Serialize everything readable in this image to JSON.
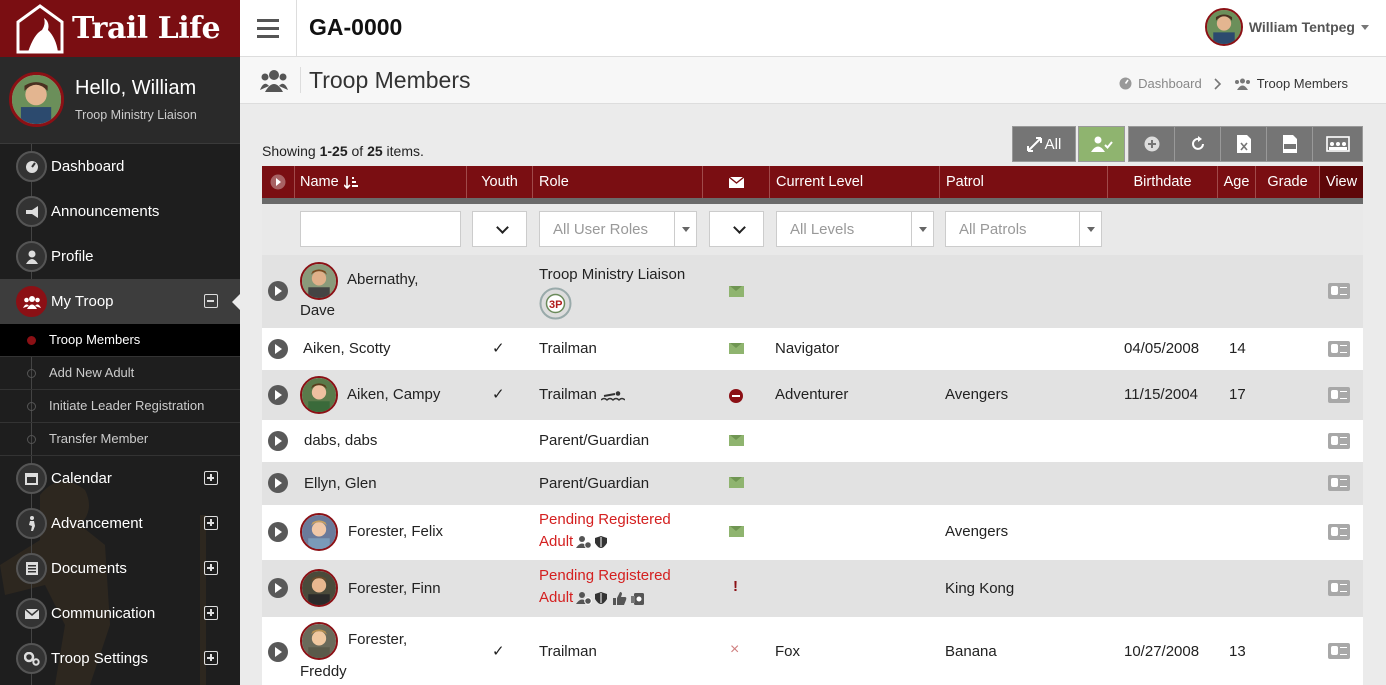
{
  "brand": {
    "name": "Trail Life"
  },
  "sidebar": {
    "hello": "Hello, William",
    "role": "Troop Ministry Liaison",
    "nav": [
      {
        "label": "Dashboard",
        "icon": "dashboard-icon"
      },
      {
        "label": "Announcements",
        "icon": "megaphone-icon"
      },
      {
        "label": "Profile",
        "icon": "user-icon"
      },
      {
        "label": "My Troop",
        "icon": "group-icon"
      },
      {
        "label": "Calendar",
        "icon": "calendar-icon"
      },
      {
        "label": "Advancement",
        "icon": "hiker-icon"
      },
      {
        "label": "Documents",
        "icon": "document-icon"
      },
      {
        "label": "Communication",
        "icon": "envelope-icon"
      },
      {
        "label": "Troop Settings",
        "icon": "gears-icon"
      }
    ],
    "sub": [
      "Troop Members",
      "Add New Adult",
      "Initiate Leader Registration",
      "Transfer Member"
    ]
  },
  "topbar": {
    "troop_id": "GA-0000",
    "user_name": "William Tentpeg"
  },
  "page": {
    "title": "Troop Members",
    "breadcrumb": {
      "home": "Dashboard",
      "current": "Troop Members"
    }
  },
  "summary": {
    "prefix": "Showing ",
    "range": "1-25",
    "mid": " of ",
    "total": "25",
    "suffix": " items."
  },
  "toolbar": {
    "all_label": "All"
  },
  "table": {
    "headers": {
      "name": "Name",
      "youth": "Youth",
      "role": "Role",
      "level": "Current Level",
      "patrol": "Patrol",
      "birthdate": "Birthdate",
      "age": "Age",
      "grade": "Grade",
      "view": "View"
    },
    "filters": {
      "roles": "All User Roles",
      "levels": "All Levels",
      "patrols": "All Patrols"
    },
    "check": "✓",
    "rows": [
      {
        "name1": "Abernathy,",
        "name2": "Dave",
        "youth": false,
        "role": "Troop Ministry Liaison",
        "level": "",
        "patrol": "",
        "birthdate": "",
        "age": "",
        "email": "ok"
      },
      {
        "name": "Aiken, Scotty",
        "youth": true,
        "role": "Trailman",
        "level": "Navigator",
        "patrol": "",
        "birthdate": "04/05/2008",
        "age": "14",
        "email": "ok"
      },
      {
        "name": "Aiken, Campy",
        "youth": true,
        "role": "Trailman",
        "level": "Adventurer",
        "patrol": "Avengers",
        "birthdate": "11/15/2004",
        "age": "17",
        "email": "blocked"
      },
      {
        "name": "dabs, dabs",
        "youth": false,
        "role": "Parent/Guardian",
        "level": "",
        "patrol": "",
        "birthdate": "",
        "age": "",
        "email": "ok"
      },
      {
        "name": "Ellyn, Glen",
        "youth": false,
        "role": "Parent/Guardian",
        "level": "",
        "patrol": "",
        "birthdate": "",
        "age": "",
        "email": "ok"
      },
      {
        "name": "Forester, Felix",
        "youth": false,
        "role1": "Pending Registered",
        "role2": "Adult",
        "level": "",
        "patrol": "Avengers",
        "birthdate": "",
        "age": "",
        "email": "ok"
      },
      {
        "name": "Forester, Finn",
        "youth": false,
        "role1": "Pending Registered",
        "role2": "Adult",
        "level": "",
        "patrol": "King Kong",
        "birthdate": "",
        "age": "",
        "email": "!"
      },
      {
        "name1": "Forester,",
        "name2": "Freddy",
        "youth": true,
        "role": "Trailman",
        "level": "Fox",
        "patrol": "Banana",
        "birthdate": "10/27/2008",
        "age": "13",
        "email": "×"
      }
    ]
  },
  "colors": {
    "brand": "#7a0e12",
    "sidebar": "#1e1e1e",
    "accent_green": "#8fb46f",
    "pending_red": "#d42020"
  }
}
